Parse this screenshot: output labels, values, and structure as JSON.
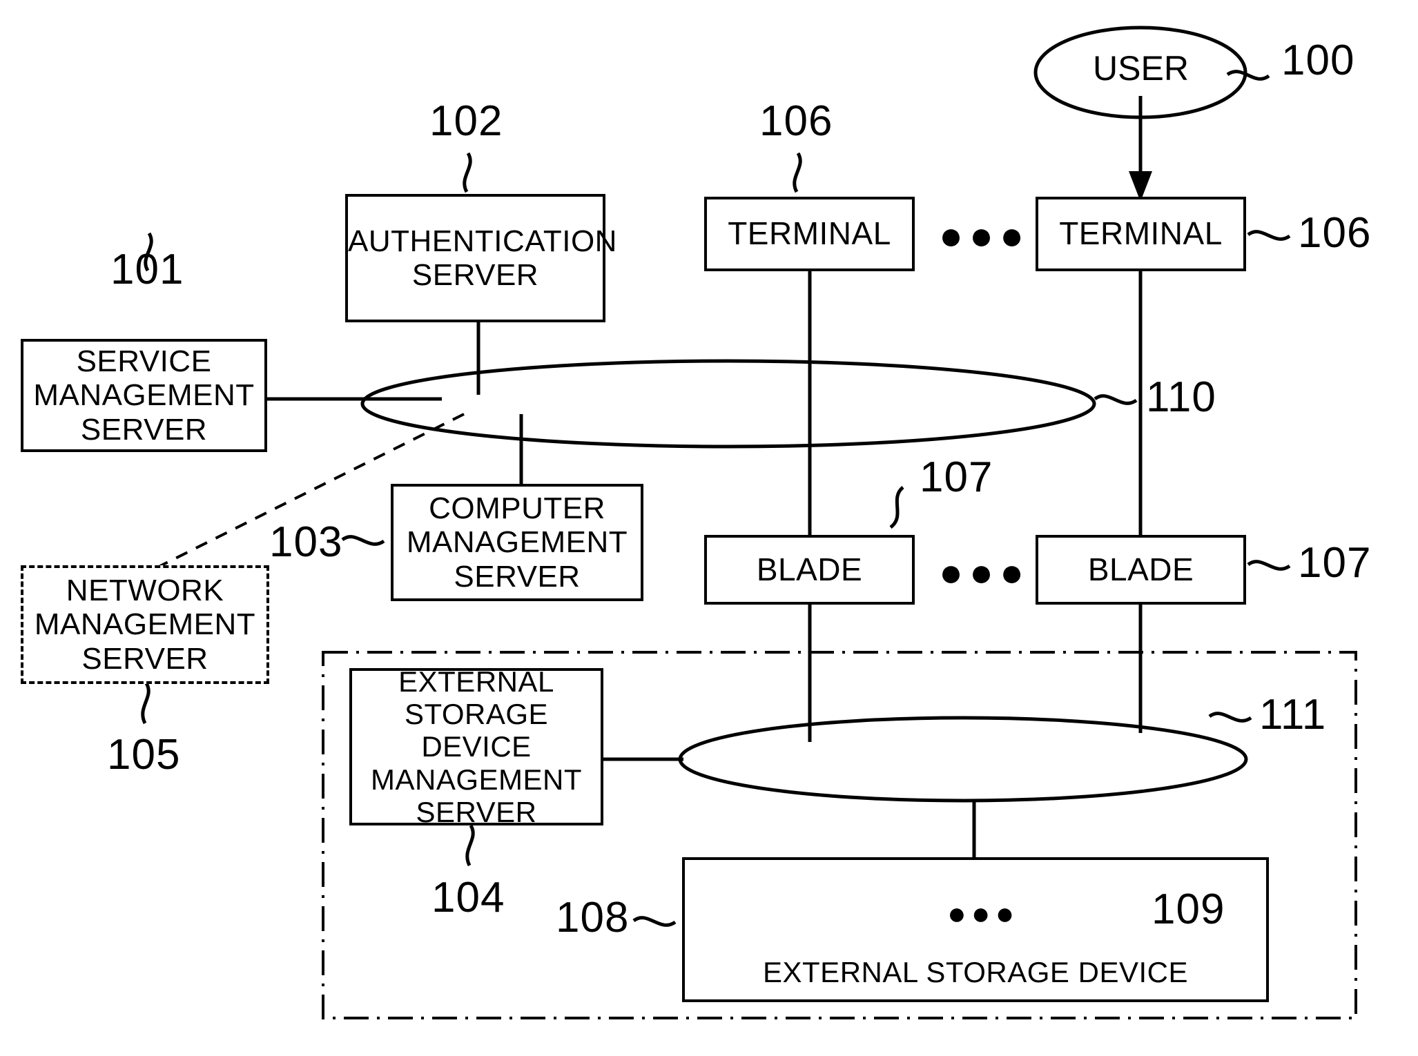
{
  "figure": {
    "type": "patent-system-block-diagram",
    "background": "#ffffff",
    "line_color": "#000000"
  },
  "nodes": {
    "user": {
      "label": "USER",
      "ref": "100",
      "shape": "ellipse"
    },
    "service_management_server": {
      "label": "SERVICE\nMANAGEMENT\nSERVER",
      "line1": "SERVICE",
      "line2": "MANAGEMENT",
      "line3": "SERVER",
      "ref": "101",
      "shape": "rect"
    },
    "authentication_server": {
      "label": "AUTHENTICATION\nSERVER",
      "line1": "AUTHENTICATION",
      "line2": "SERVER",
      "ref": "102",
      "shape": "rect"
    },
    "computer_management_server": {
      "label": "COMPUTER\nMANAGEMENT\nSERVER",
      "line1": "COMPUTER",
      "line2": "MANAGEMENT",
      "line3": "SERVER",
      "ref": "103",
      "shape": "rect"
    },
    "external_storage_device_management_server": {
      "label": "EXTERNAL\nSTORAGE DEVICE\nMANAGEMENT\nSERVER",
      "line1": "EXTERNAL",
      "line2": "STORAGE DEVICE",
      "line3": "MANAGEMENT",
      "line4": "SERVER",
      "ref": "104",
      "shape": "rect"
    },
    "network_management_server": {
      "label": "NETWORK\nMANAGEMENT\nSERVER",
      "line1": "NETWORK",
      "line2": "MANAGEMENT",
      "line3": "SERVER",
      "ref": "105",
      "shape": "rect-dashed"
    },
    "terminal_left": {
      "label": "TERMINAL",
      "ref": "106",
      "shape": "rect"
    },
    "terminal_right": {
      "label": "TERMINAL",
      "ref": "106",
      "shape": "rect"
    },
    "blade_left": {
      "label": "BLADE",
      "ref": "107",
      "shape": "rect"
    },
    "blade_right": {
      "label": "BLADE",
      "ref": "107",
      "shape": "rect"
    },
    "external_storage_device": {
      "label": "EXTERNAL STORAGE DEVICE",
      "ref": "108",
      "shape": "rect"
    },
    "disk": {
      "ref": "109",
      "shape": "cylinder"
    },
    "network_110": {
      "ref": "110",
      "shape": "ellipse"
    },
    "network_111": {
      "ref": "111",
      "shape": "ellipse"
    },
    "storage_domain": {
      "shape": "dash-dot-rect"
    }
  },
  "ellipsis": {
    "terminals": "●●●",
    "blades": "●●●",
    "disks": "●●●"
  },
  "ref_numbers": {
    "r100": "100",
    "r101": "101",
    "r102": "102",
    "r103": "103",
    "r104": "104",
    "r105": "105",
    "r106_top": "106",
    "r106_right": "106",
    "r107_top": "107",
    "r107_right": "107",
    "r108": "108",
    "r109": "109",
    "r110": "110",
    "r111": "111"
  }
}
